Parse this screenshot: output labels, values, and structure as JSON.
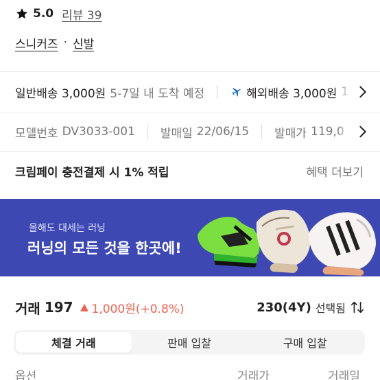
{
  "rating": {
    "score": "5.0",
    "review_link": "리뷰 39",
    "icon": "star-icon"
  },
  "category": {
    "first": "스니커즈",
    "separator": "·",
    "second": "신발"
  },
  "shipping": {
    "normal_label": "일반배송 3,000원",
    "normal_eta": "5-7일 내 도착 예정",
    "overseas_icon": "airplane-icon",
    "overseas_label": "해외배송 3,000원",
    "overseas_eta_partial": "1",
    "accent_color": "#1f6fd1"
  },
  "specs": {
    "model_label": "모델번호",
    "model_value": "DV3033-001",
    "release_label": "발매일",
    "release_value": "22/06/15",
    "price_label": "발매가",
    "price_value_partial": "119,0"
  },
  "cream_pay": {
    "text": "크림페이 충전결제 시 1% 적립",
    "benefit_link": "혜택 더보기"
  },
  "banner": {
    "subtitle": "올해도 대세는 러닝",
    "title": "러닝의 모든 것을 한곳에!",
    "background": "#3d48b3"
  },
  "trades": {
    "label": "거래",
    "count": "197",
    "change": "1,000원(+0.8%)",
    "change_color": "#ef6253",
    "size_value": "230(4Y)",
    "size_selected": "선택됨"
  },
  "tabs": [
    {
      "label": "체결 거래",
      "active": true
    },
    {
      "label": "판매 입찰",
      "active": false
    },
    {
      "label": "구매 입찰",
      "active": false
    }
  ],
  "table": {
    "headers": [
      "옵션",
      "거래가",
      "거래일"
    ]
  }
}
